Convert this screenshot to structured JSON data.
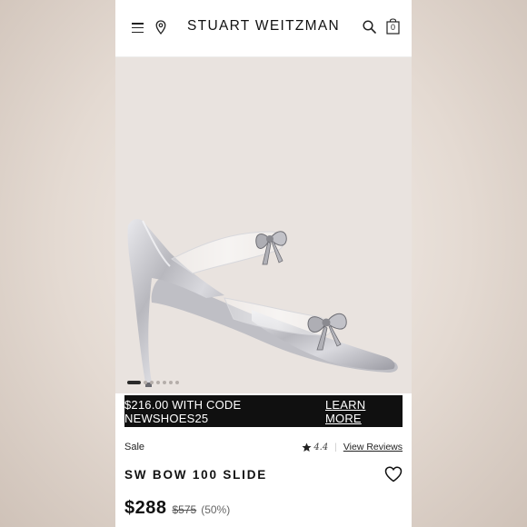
{
  "header": {
    "brand": "STUART WEITZMAN",
    "cart_count": "0"
  },
  "icons": {
    "menu": "hamburger-menu-icon",
    "store": "location-pin-icon",
    "search": "search-icon",
    "cart": "shopping-bag-icon",
    "wishlist": "heart-icon",
    "rating": "star-icon"
  },
  "carousel": {
    "total": 7,
    "active_index": 0
  },
  "promo": {
    "text": "$216.00 WITH CODE NEWSHOES25",
    "link": "LEARN MORE"
  },
  "product": {
    "badge": "Sale",
    "rating": "4.4",
    "reviews_link": "View Reviews",
    "name": "SW BOW 100 SLIDE",
    "price": "$288",
    "original_price": "$575",
    "discount": "(50%)"
  },
  "colors": {
    "promo_bg": "#101010",
    "hero_bg": "#e9e3df",
    "text": "#111111"
  }
}
